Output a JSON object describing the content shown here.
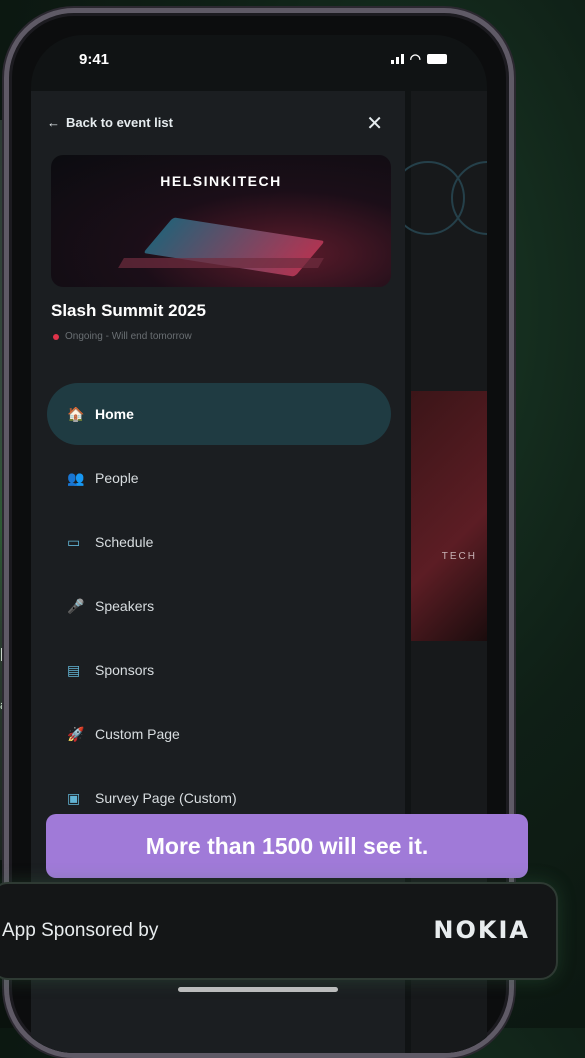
{
  "status_bar": {
    "time": "9:41"
  },
  "drawer": {
    "back_label": "Back to event list",
    "close_label": "✕",
    "banner_brand": "HELSINKITECH",
    "event_title": "Slash Summit 2025",
    "event_status": "Ongoing - Will end tomorrow",
    "nav": [
      {
        "label": "Home",
        "icon": "home-icon",
        "glyph": "🏠",
        "active": true
      },
      {
        "label": "People",
        "icon": "people-icon",
        "glyph": "👥",
        "active": false
      },
      {
        "label": "Schedule",
        "icon": "calendar-icon",
        "glyph": "▭",
        "active": false
      },
      {
        "label": "Speakers",
        "icon": "speakers-icon",
        "glyph": "🎤",
        "active": false
      },
      {
        "label": "Sponsors",
        "icon": "sponsors-icon",
        "glyph": "▤",
        "active": false
      },
      {
        "label": "Custom Page",
        "icon": "rocket-icon",
        "glyph": "🚀",
        "active": false
      },
      {
        "label": "Survey Page (Custom)",
        "icon": "survey-icon",
        "glyph": "▣",
        "active": false
      }
    ]
  },
  "background_app": {
    "label_left": "H",
    "label_left2": "at",
    "banner_text": "TECH"
  },
  "callout": {
    "text": "More than 1500 will see it."
  },
  "sponsor": {
    "label": "App Sponsored by",
    "logo": "NOKIA"
  },
  "colors": {
    "accent": "#a07ad8",
    "active_nav": "#1f3b42",
    "status_dot": "#e0334a"
  }
}
